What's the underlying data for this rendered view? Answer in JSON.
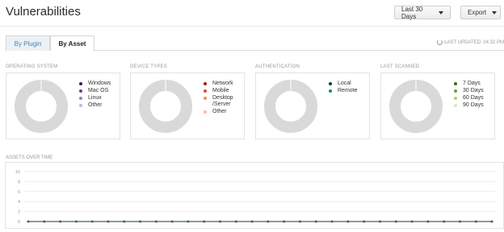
{
  "header": {
    "title": "Vulnerabilities",
    "range_label": "Last 30 Days",
    "export_label": "Export"
  },
  "tabs": [
    {
      "label": "By Plugin",
      "active": false
    },
    {
      "label": "By Asset",
      "active": true
    }
  ],
  "last_updated": "LAST UPDATED: 04:32 PM",
  "icons": {
    "refresh": "refresh-icon",
    "caret": "caret-down-icon"
  },
  "colors": {
    "accent": "#3a88c7",
    "donut_empty": "#d9d9d9",
    "line": "#4a5d6a"
  },
  "panels": [
    {
      "title": "OPERATING SYSTEM",
      "legend": [
        {
          "label": "Windows",
          "color": "#3d1f4f"
        },
        {
          "label": "Mac OS",
          "color": "#6a3d9a"
        },
        {
          "label": "Linux",
          "color": "#9e7bc9"
        },
        {
          "label": "Other",
          "color": "#c9b3e0"
        }
      ]
    },
    {
      "title": "DEVICE TYPES",
      "legend": [
        {
          "label": "Network",
          "color": "#8a2a0a"
        },
        {
          "label": "Mobile",
          "color": "#d7501f"
        },
        {
          "label": "Desktop /Server",
          "color": "#f28b4a"
        },
        {
          "label": "Other",
          "color": "#f6b6a0"
        }
      ]
    },
    {
      "title": "AUTHENTICATION",
      "legend": [
        {
          "label": "Local",
          "color": "#0d3b3b"
        },
        {
          "label": "Remote",
          "color": "#1a8a80"
        }
      ]
    },
    {
      "title": "LAST SCANNED",
      "legend": [
        {
          "label": "7 Days",
          "color": "#3e6b1e"
        },
        {
          "label": "30 Days",
          "color": "#5fa33a"
        },
        {
          "label": "60 Days",
          "color": "#a7d27a"
        },
        {
          "label": "90 Days",
          "color": "#d6e9b8"
        }
      ]
    }
  ],
  "assets_over_time": {
    "title": "ASSETS OVER TIME"
  },
  "chart_data": {
    "type": "line",
    "title": "ASSETS OVER TIME",
    "ylim": [
      0,
      10
    ],
    "yticks": [
      "10",
      "8",
      "6",
      "4",
      "2",
      "0"
    ],
    "grid": true,
    "series": [
      {
        "values": [
          0,
          0,
          0,
          0,
          0,
          0,
          0,
          0,
          0,
          0,
          0,
          0,
          0,
          0,
          0,
          0,
          0,
          0,
          0,
          0,
          0,
          0,
          0,
          0,
          0,
          0,
          0,
          0,
          0,
          0
        ]
      }
    ]
  }
}
